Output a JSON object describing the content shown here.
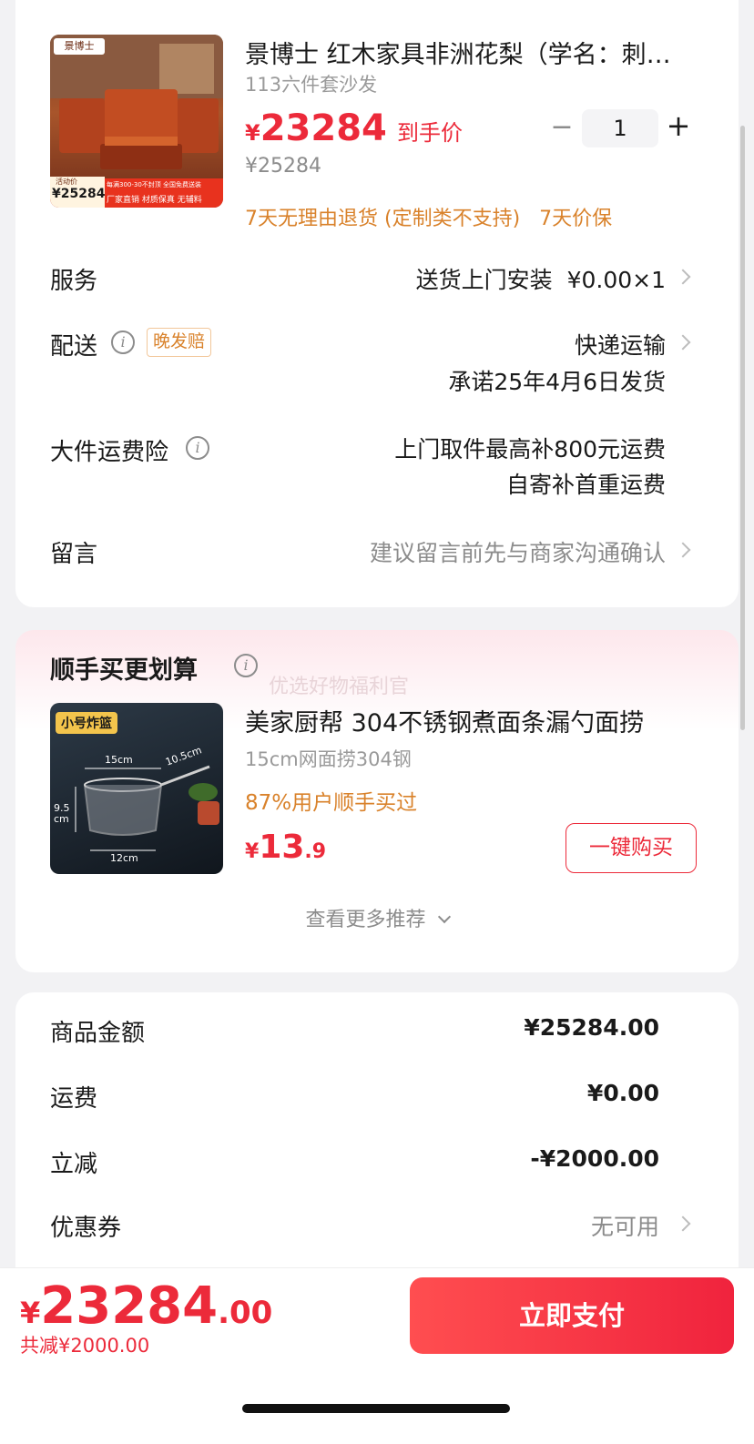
{
  "product": {
    "title": "景博士 红木家具非洲花梨（学名：刺猬紫檀）",
    "spec": "113六件套沙发",
    "currency": "¥",
    "price": "23284",
    "price_tag": "到手价",
    "orig_price": "¥25284",
    "qty": "1",
    "minus": "−",
    "plus": "+",
    "guarantee": "7天无理由退货 (定制类不支持)   7天价保",
    "thumb": {
      "brand": "景博士",
      "promo_label": "活动价",
      "promo_price": "¥25284",
      "promo_strip": "厂家直销 材质保真 无辅料",
      "promo_top": "每满300-30不封顶 全国免费送装"
    }
  },
  "rows": {
    "service_label": "服务",
    "service_value": "送货上门安装  ¥0.00×1",
    "delivery_label": "配送",
    "delivery_badge": "晚发赔",
    "delivery_value": "快递运输",
    "delivery_promise": "承诺25年4月6日发货",
    "insurance_label": "大件运费险",
    "insurance_line1": "上门取件最高补800元运费",
    "insurance_line2": "自寄补首重运费",
    "message_label": "留言",
    "message_placeholder": "建议留言前先与商家沟通确认"
  },
  "addon": {
    "heading": "顺手买更划算",
    "watermark": "优选好物福利官",
    "title": "美家厨帮 304不锈钢煮面条漏勺面捞",
    "spec": "15cm网面捞304钢",
    "stat": "87%用户顺手买过",
    "currency": "¥",
    "price_int": "13",
    "price_dec": ".9",
    "buy_label": "一键购买",
    "more_label": "查看更多推荐",
    "thumb": {
      "tag": "小号炸篮",
      "dim_w": "15cm",
      "dim_h": "9.5 cm",
      "dim_b": "12cm",
      "dim_handle": "10.5cm"
    }
  },
  "summary": {
    "goods_label": "商品金额",
    "goods_value": "¥25284.00",
    "shipping_label": "运费",
    "shipping_value": "¥0.00",
    "discount_label": "立减",
    "discount_value": "-¥2000.00",
    "coupon_label": "优惠券",
    "coupon_value": "无可用"
  },
  "footer": {
    "currency": "¥",
    "total_int": "23284",
    "total_dec": ".00",
    "saved": "共减¥2000.00",
    "pay_label": "立即支付"
  },
  "colors": {
    "accent": "#ec2a3a",
    "orange": "#d9822b"
  }
}
